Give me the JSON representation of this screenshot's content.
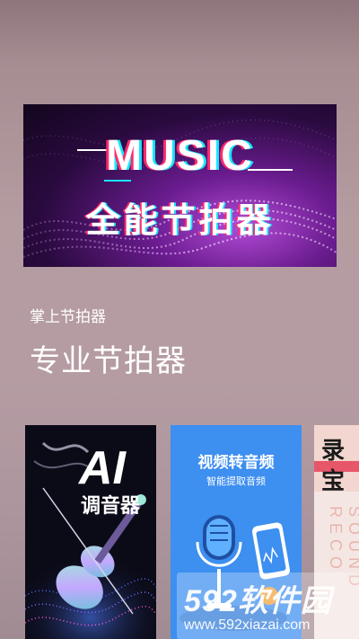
{
  "banner": {
    "title": "MUSIC",
    "subtitle": "全能节拍器"
  },
  "intro": {
    "subtitle": "掌上节拍器",
    "headline": "专业节拍器"
  },
  "cards": [
    {
      "title": "AI",
      "subtitle": "调音器"
    },
    {
      "title": "视频转音频",
      "subtitle": "智能提取音频"
    },
    {
      "title_line1": "录",
      "title_line2": "宝",
      "side_text": "SOUND RECO"
    }
  ],
  "watermark": {
    "logo": "592软件园",
    "url": "www.592xiazai.com"
  }
}
